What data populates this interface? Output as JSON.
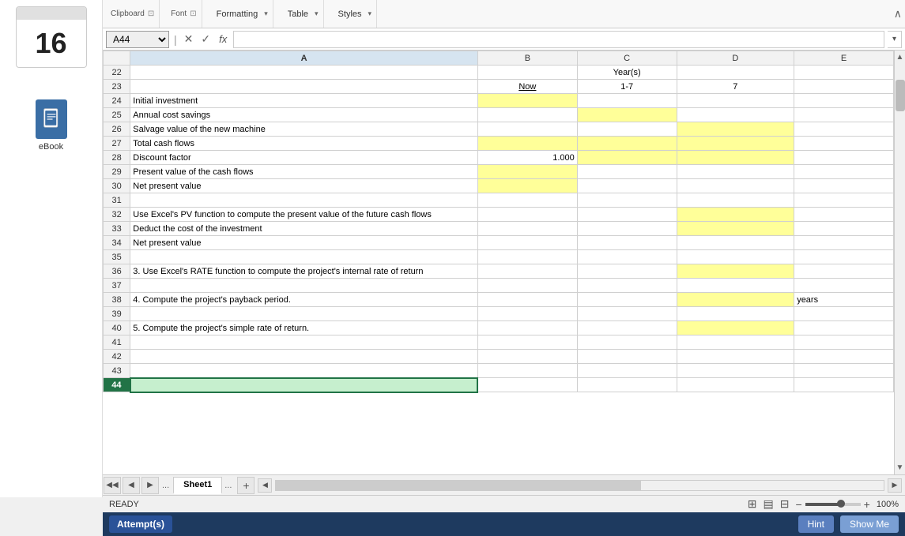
{
  "sidebar": {
    "calendar": {
      "month": "",
      "day": "16"
    },
    "ebook": {
      "label": "eBook"
    }
  },
  "ribbon": {
    "groups": [
      {
        "name": "Clipboard",
        "label": "Clipboard"
      },
      {
        "name": "Font",
        "label": "Font"
      },
      {
        "name": "Styles",
        "label": "Styles"
      }
    ],
    "formatting_label": "Formatting",
    "table_label": "Table",
    "styles_label": "Styles"
  },
  "formula_bar": {
    "cell_ref": "A44",
    "fx_label": "fx"
  },
  "grid": {
    "col_headers": [
      "A",
      "B",
      "C",
      "D",
      "E"
    ],
    "rows": [
      {
        "row": "22",
        "A": "",
        "B": "",
        "C": "Year(s)",
        "D": "",
        "E": ""
      },
      {
        "row": "23",
        "A": "",
        "B": "Now",
        "C": "1-7",
        "D": "7",
        "E": ""
      },
      {
        "row": "24",
        "A": "Initial investment",
        "B": "",
        "C": "",
        "D": "",
        "E": ""
      },
      {
        "row": "25",
        "A": "Annual cost savings",
        "B": "",
        "C": "",
        "D": "",
        "E": ""
      },
      {
        "row": "26",
        "A": "Salvage value of the new machine",
        "B": "",
        "C": "",
        "D": "",
        "E": ""
      },
      {
        "row": "27",
        "A": "Total cash flows",
        "B": "",
        "C": "",
        "D": "",
        "E": ""
      },
      {
        "row": "28",
        "A": "Discount factor",
        "B": "1.000",
        "C": "",
        "D": "",
        "E": ""
      },
      {
        "row": "29",
        "A": "Present value of the cash flows",
        "B": "",
        "C": "",
        "D": "",
        "E": ""
      },
      {
        "row": "30",
        "A": "Net present value",
        "B": "",
        "C": "",
        "D": "",
        "E": ""
      },
      {
        "row": "31",
        "A": "",
        "B": "",
        "C": "",
        "D": "",
        "E": ""
      },
      {
        "row": "32",
        "A": "Use Excel's PV function to compute the present value of the future cash flows",
        "B": "",
        "C": "",
        "D": "",
        "E": ""
      },
      {
        "row": "33",
        "A": "Deduct the cost of the investment",
        "B": "",
        "C": "",
        "D": "",
        "E": ""
      },
      {
        "row": "34",
        "A": "Net present value",
        "B": "",
        "C": "",
        "D": "",
        "E": ""
      },
      {
        "row": "35",
        "A": "",
        "B": "",
        "C": "",
        "D": "",
        "E": ""
      },
      {
        "row": "36",
        "A": "3. Use Excel's RATE function to compute the project's internal rate of return",
        "B": "",
        "C": "",
        "D": "",
        "E": ""
      },
      {
        "row": "37",
        "A": "",
        "B": "",
        "C": "",
        "D": "",
        "E": ""
      },
      {
        "row": "38",
        "A": "4. Compute the project's payback period.",
        "B": "",
        "C": "",
        "D": "",
        "E": "years"
      },
      {
        "row": "39",
        "A": "",
        "B": "",
        "C": "",
        "D": "",
        "E": ""
      },
      {
        "row": "40",
        "A": "5. Compute the project's simple rate of return.",
        "B": "",
        "C": "",
        "D": "",
        "E": ""
      },
      {
        "row": "41",
        "A": "",
        "B": "",
        "C": "",
        "D": "",
        "E": ""
      },
      {
        "row": "42",
        "A": "",
        "B": "",
        "C": "",
        "D": "",
        "E": ""
      },
      {
        "row": "43",
        "A": "",
        "B": "",
        "C": "",
        "D": "",
        "E": ""
      },
      {
        "row": "44",
        "A": "",
        "B": "",
        "C": "",
        "D": "",
        "E": ""
      }
    ]
  },
  "sheet_tabs": {
    "tabs": [
      "Sheet1"
    ],
    "active": "Sheet1"
  },
  "status_bar": {
    "ready_text": "READY",
    "zoom_pct": "100%"
  },
  "bottom_bar": {
    "attempts_label": "Attempt(s)",
    "hint_label": "Hint",
    "show_me_label": "Show Me"
  }
}
